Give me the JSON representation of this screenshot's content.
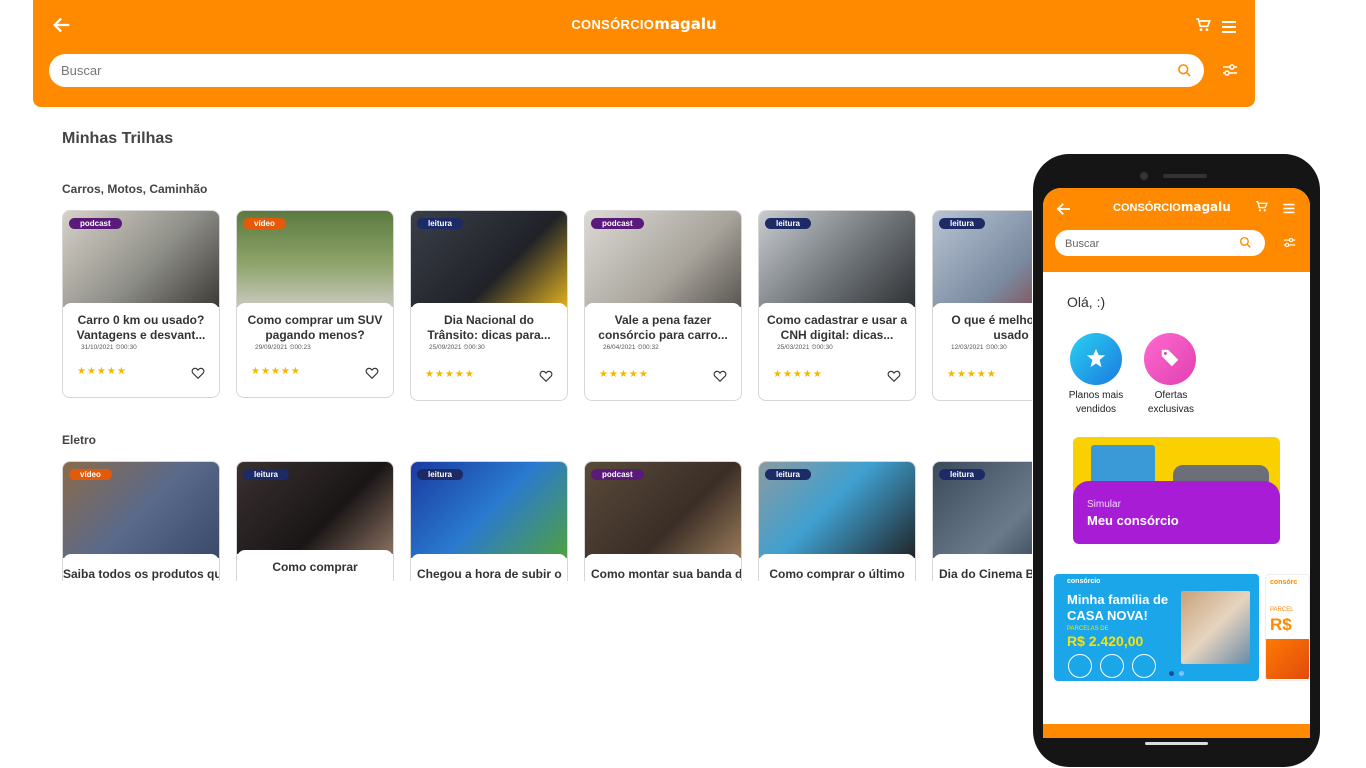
{
  "header": {
    "logo_a": "CONSÓRCIO",
    "logo_b": "magalu",
    "search_placeholder": "Buscar"
  },
  "page_title": "Minhas Trilhas",
  "sections": [
    {
      "title": "Carros, Motos, Caminhão",
      "cards": [
        {
          "badge": "podcast",
          "title": "Carro 0 km ou usado? Vantagens e desvant...",
          "date": "31/10/2021",
          "time": "00:30"
        },
        {
          "badge": "vídeo",
          "title": "Como comprar um SUV pagando menos?",
          "date": "29/09/2021",
          "time": "00:23"
        },
        {
          "badge": "leitura",
          "title": "Dia Nacional do Trânsito: dicas para...",
          "date": "25/09/2021",
          "time": "00:30"
        },
        {
          "badge": "podcast",
          "title": "Vale a pena fazer consórcio para carro...",
          "date": "26/04/2021",
          "time": "00:32"
        },
        {
          "badge": "leitura",
          "title": "Como cadastrar e usar a CNH digital: dicas...",
          "date": "25/03/2021",
          "time": "00:30"
        },
        {
          "badge": "leitura",
          "title": "O que é melhor: c ou usado",
          "date": "12/03/2021",
          "time": "00:30"
        }
      ]
    },
    {
      "title": "Eletro",
      "cards": [
        {
          "badge": "vídeo",
          "title": "Saiba todos os produtos que"
        },
        {
          "badge": "leitura",
          "title": "Como comprar"
        },
        {
          "badge": "leitura",
          "title": "Chegou a hora de subir o"
        },
        {
          "badge": "podcast",
          "title": "Como montar sua banda de"
        },
        {
          "badge": "leitura",
          "title": "Como comprar o último"
        },
        {
          "badge": "leitura",
          "title": "Dia do Cinema Br"
        }
      ]
    }
  ],
  "stars": "★★★★★",
  "phone": {
    "search_placeholder": "Buscar",
    "greeting": "Olá, :)",
    "shortcuts": [
      "Planos mais vendidos",
      "Ofertas exclusivas"
    ],
    "simulate_small": "Simular",
    "simulate_big": "Meu consórcio",
    "banner": {
      "brand": "consórcio",
      "headline": "Minha família de CASA NOVA!",
      "parcelas_label": "PARCELAS DE",
      "price": "R$ 2.420,00",
      "second_brand": "consórc",
      "second_label": "PARCEL",
      "second_price": "R$"
    }
  },
  "colors": {
    "brand_orange": "#ff8a00",
    "podcast": "#5a1a7a",
    "video": "#e25a0a",
    "leitura": "#1c2a66",
    "star": "#f6b600"
  }
}
